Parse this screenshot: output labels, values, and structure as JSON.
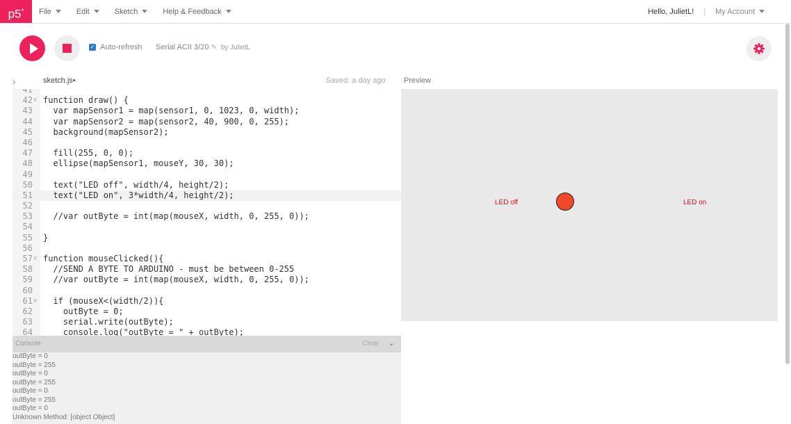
{
  "nav": {
    "logo": "p5",
    "logo_sup": "*",
    "menu": [
      {
        "label": "File"
      },
      {
        "label": "Edit"
      },
      {
        "label": "Sketch"
      },
      {
        "label": "Help & Feedback"
      }
    ],
    "greeting": "Hello, JulietL!",
    "separator": "|",
    "account": "My Account"
  },
  "toolbar": {
    "auto_refresh_label": "Auto-refresh",
    "auto_refresh_checked": true,
    "sketch_name": "Serial ACII 3/20",
    "by_user": "by JulietL"
  },
  "editor": {
    "file_tab": "sketch.js",
    "file_modified_mark": "•",
    "saved_status": "Saved: a day ago",
    "active_line": "51",
    "lines": [
      {
        "n": "41",
        "fold": "",
        "code": ""
      },
      {
        "n": "42",
        "fold": "∨",
        "code": "function draw() {"
      },
      {
        "n": "43",
        "fold": "",
        "code": "  var mapSensor1 = map(sensor1, 0, 1023, 0, width);"
      },
      {
        "n": "44",
        "fold": "",
        "code": "  var mapSensor2 = map(sensor2, 40, 900, 0, 255);"
      },
      {
        "n": "45",
        "fold": "",
        "code": "  background(mapSensor2);"
      },
      {
        "n": "46",
        "fold": "",
        "code": ""
      },
      {
        "n": "47",
        "fold": "",
        "code": "  fill(255, 0, 0);"
      },
      {
        "n": "48",
        "fold": "",
        "code": "  ellipse(mapSensor1, mouseY, 30, 30);"
      },
      {
        "n": "49",
        "fold": "",
        "code": ""
      },
      {
        "n": "50",
        "fold": "",
        "code": "  text(\"LED off\", width/4, height/2);"
      },
      {
        "n": "51",
        "fold": "",
        "code": "  text(\"LED on\", 3*width/4, height/2);"
      },
      {
        "n": "52",
        "fold": "",
        "code": ""
      },
      {
        "n": "53",
        "fold": "",
        "code": "  //var outByte = int(map(mouseX, width, 0, 255, 0));"
      },
      {
        "n": "54",
        "fold": "",
        "code": ""
      },
      {
        "n": "55",
        "fold": "",
        "code": "}"
      },
      {
        "n": "56",
        "fold": "",
        "code": ""
      },
      {
        "n": "57",
        "fold": "∨",
        "code": "function mouseClicked(){"
      },
      {
        "n": "58",
        "fold": "",
        "code": "  //SEND A BYTE TO ARDUINO - must be between 0-255"
      },
      {
        "n": "59",
        "fold": "",
        "code": "  //var outByte = int(map(mouseX, width, 0, 255, 0));"
      },
      {
        "n": "60",
        "fold": "",
        "code": ""
      },
      {
        "n": "61",
        "fold": "∨",
        "code": "  if (mouseX<(width/2)){"
      },
      {
        "n": "62",
        "fold": "",
        "code": "    outByte = 0;"
      },
      {
        "n": "63",
        "fold": "",
        "code": "    serial.write(outByte);"
      },
      {
        "n": "64",
        "fold": "",
        "code": "    console.log(\"outByte = \" + outByte);"
      }
    ]
  },
  "console": {
    "title": "Console",
    "clear_label": "Clear",
    "lines": [
      "outByte = 0",
      "outByte = 255",
      "outByte = 0",
      "outByte = 255",
      "outByte = 0",
      "outByte = 255",
      "outByte = 0",
      "Unknown Method: [object Object]"
    ]
  },
  "preview": {
    "label": "Preview",
    "led_off": "LED off",
    "led_on": "LED on"
  },
  "colors": {
    "accent": "#ed225d",
    "checkbox": "#2d7bd0",
    "canvas_bg": "#e9e9e9",
    "ellipse_fill": "#f04a2a",
    "canvas_text": "#e01010"
  },
  "icons": {
    "play": "play-icon",
    "stop": "stop-icon",
    "gear": "gear-icon",
    "pencil": "pencil-icon",
    "expand": "chevron-right-icon",
    "collapse": "chevron-down-icon"
  }
}
